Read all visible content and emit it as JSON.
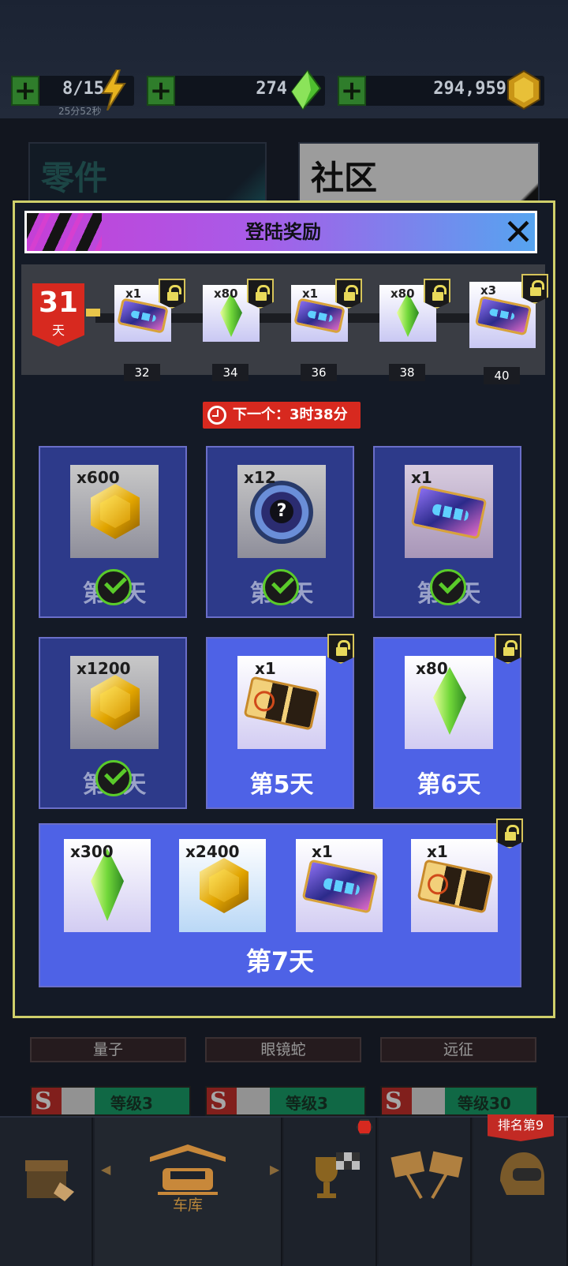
{
  "resources": {
    "energy": {
      "value": "8/15",
      "timer": "25分52秒",
      "icon": "lightning-icon"
    },
    "gems": {
      "value": "274",
      "icon": "green-gem-icon"
    },
    "coins": {
      "value": "294,959",
      "icon": "gold-hex-coin-icon"
    }
  },
  "background": {
    "card_left_title": "零件",
    "card_right_title": "社区",
    "car_names": [
      "量子",
      "眼镜蛇",
      "远征"
    ],
    "car_levels": [
      "等级3",
      "等级3",
      "等级30"
    ],
    "info_icon": "info-icon"
  },
  "modal": {
    "title": "登陆奖励",
    "close": "close-icon",
    "current_day": {
      "number": "31",
      "unit": "天"
    },
    "milestones": [
      {
        "qty": "x1",
        "day": "32",
        "item": "blue-card"
      },
      {
        "qty": "x80",
        "day": "34",
        "item": "gem"
      },
      {
        "qty": "x1",
        "day": "36",
        "item": "blue-card"
      },
      {
        "qty": "x80",
        "day": "38",
        "item": "gem"
      },
      {
        "qty": "x3",
        "day": "40",
        "item": "blue-card"
      }
    ],
    "next_timer": "下一个：3时38分",
    "days": [
      {
        "qty": "x600",
        "label": "第1天",
        "item": "coin",
        "claimed": true
      },
      {
        "qty": "x12",
        "label": "第2天",
        "item": "mystery",
        "claimed": true
      },
      {
        "qty": "x1",
        "label": "第3天",
        "item": "blue-card",
        "claimed": true
      },
      {
        "qty": "x1200",
        "label": "第4天",
        "item": "coin",
        "claimed": true
      },
      {
        "qty": "x1",
        "label": "第5天",
        "item": "orange-card",
        "claimed": false
      },
      {
        "qty": "x80",
        "label": "第6天",
        "item": "gem",
        "claimed": false
      }
    ],
    "day7": {
      "label": "第7天",
      "items": [
        {
          "qty": "x300",
          "item": "gem"
        },
        {
          "qty": "x2400",
          "item": "coin"
        },
        {
          "qty": "x1",
          "item": "blue-card"
        },
        {
          "qty": "x1",
          "item": "orange-card"
        }
      ]
    }
  },
  "nav": {
    "garage": "车库",
    "rank": "排名第9"
  },
  "colors": {
    "accent_red": "#d7291f",
    "day_card_blue": "#4e62e6",
    "claimed_card": "#2d3a8a",
    "check_green": "#5acb2a",
    "lock_gold": "#e8d95a"
  }
}
